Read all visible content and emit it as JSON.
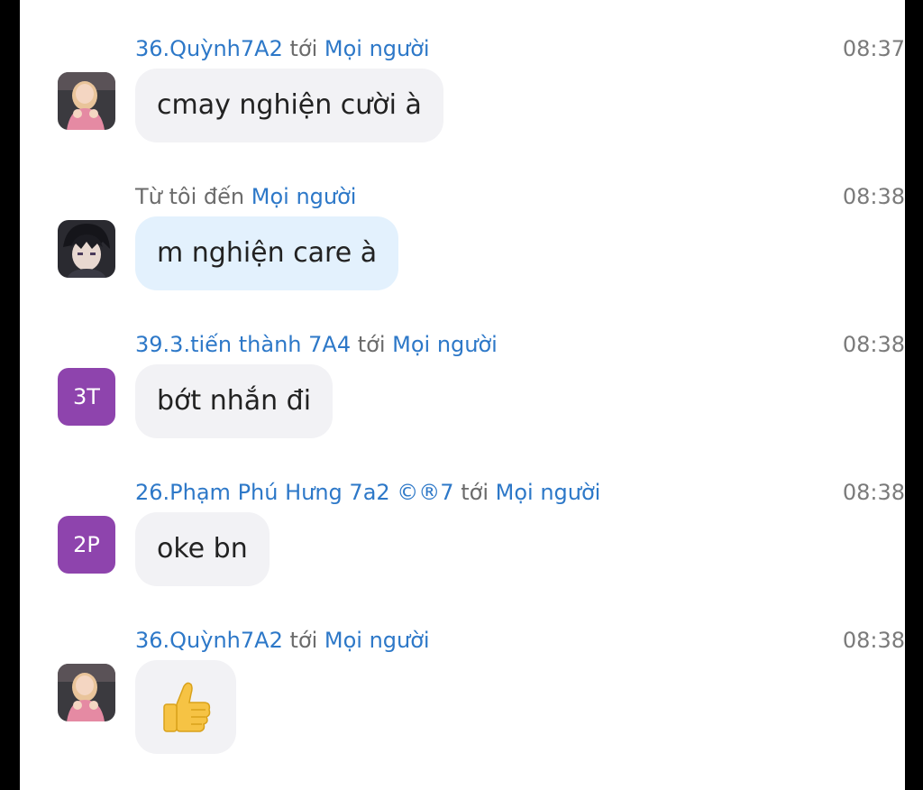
{
  "chat": {
    "messages": [
      {
        "sender": "36.Quỳnh7A2",
        "to_word": "tới",
        "recipient": "Mọi người",
        "time": "08:37",
        "text": "cmay nghiện cười à",
        "avatar": "photo-girl-pink"
      },
      {
        "sender": "",
        "to_word": "Từ tôi đến",
        "recipient": "Mọi người",
        "time": "08:38",
        "text": "m nghiện care à",
        "avatar": "photo-anime-boy"
      },
      {
        "sender": "39.3.tiến thành 7A4",
        "to_word": "tới",
        "recipient": "Mọi người",
        "time": "08:38",
        "text": "bớt nhắn đi",
        "avatar_initials": "3T"
      },
      {
        "sender": "26.Phạm Phú Hưng 7a2 ©®7",
        "to_word": "tới",
        "recipient": "Mọi người",
        "time": "08:38",
        "text": "oke bn",
        "avatar_initials": "2P"
      },
      {
        "sender": "36.Quỳnh7A2",
        "to_word": "tới",
        "recipient": "Mọi người",
        "time": "08:38",
        "text": "👍",
        "avatar": "photo-girl-pink"
      }
    ]
  },
  "colors": {
    "name_link": "#2d78c8",
    "bubble_other": "#f2f2f5",
    "bubble_self": "#e3f1fd",
    "initials_avatar": "#8e44ad"
  }
}
